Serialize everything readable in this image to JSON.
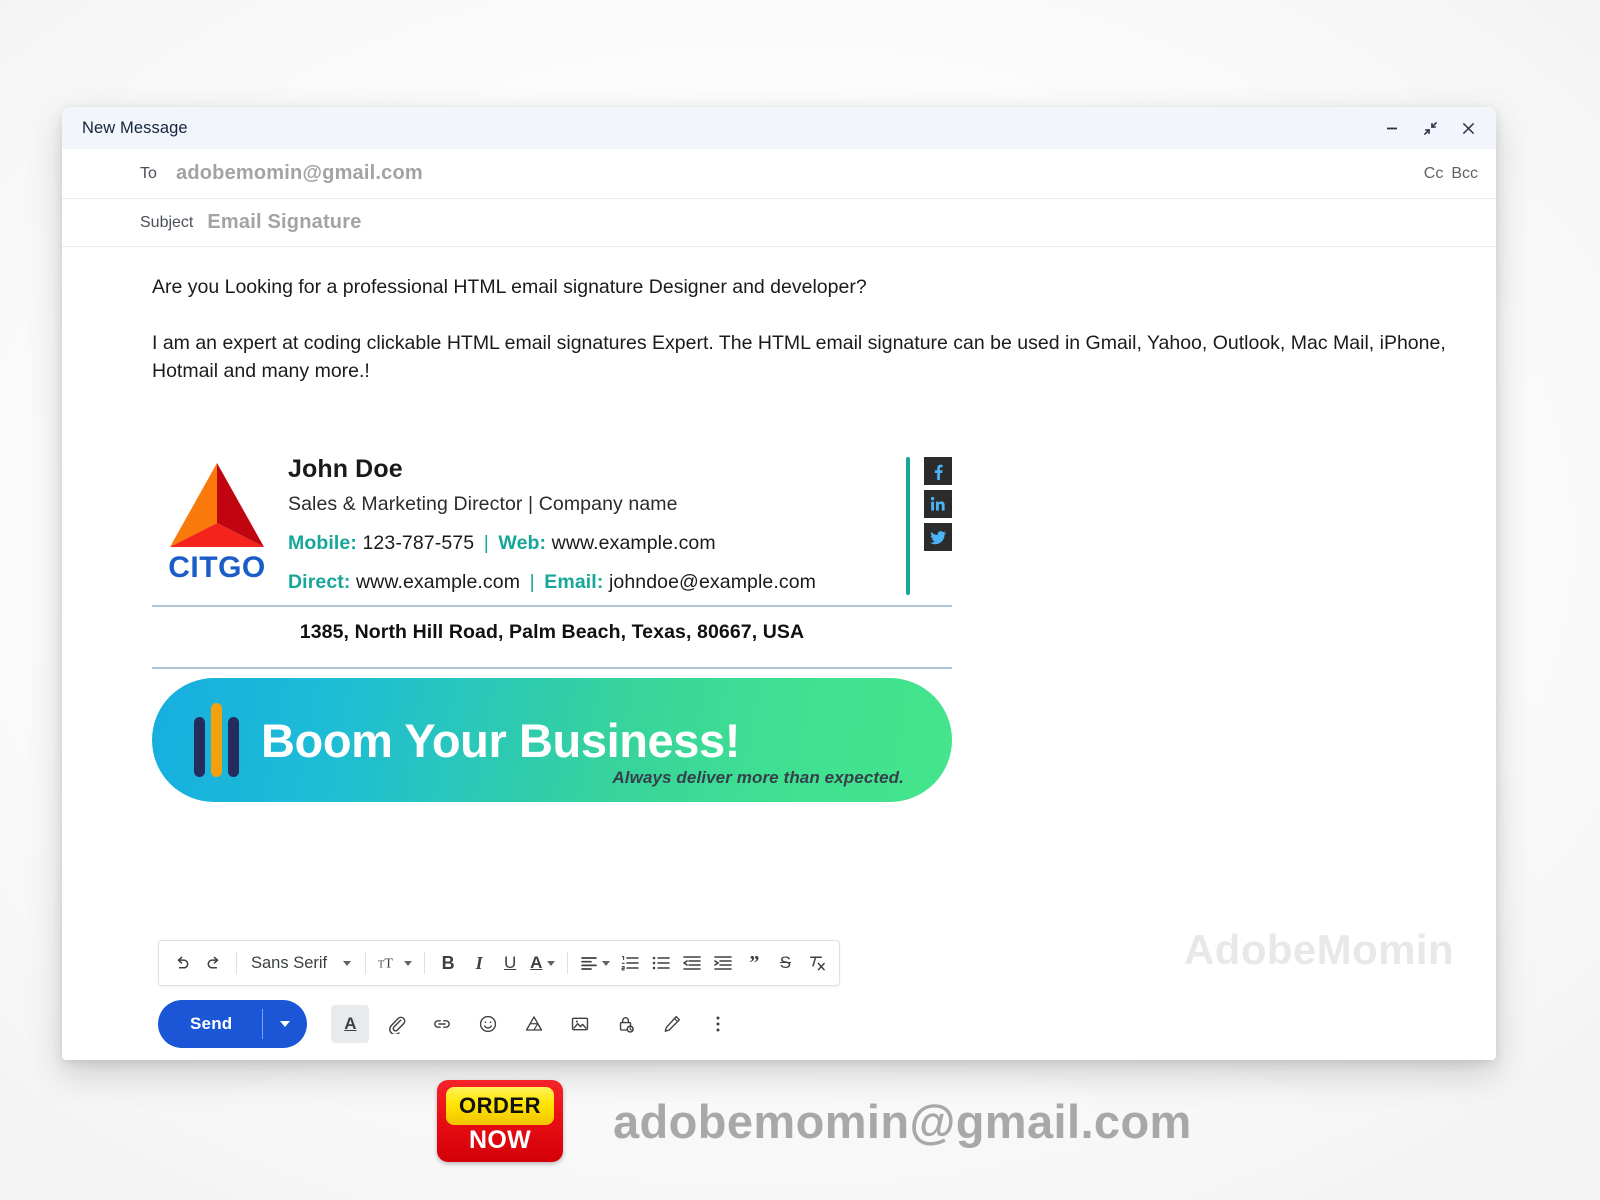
{
  "window": {
    "title": "New Message",
    "controls": [
      {
        "name": "minimize",
        "label": "–"
      },
      {
        "name": "exit-full-screen",
        "label": "↙↗"
      },
      {
        "name": "close",
        "label": "×"
      }
    ]
  },
  "fields": {
    "to_label": "To",
    "to_value": "adobemomin@gmail.com",
    "cc_label": "Cc",
    "bcc_label": "Bcc",
    "subject_label": "Subject",
    "subject_value": "Email Signature"
  },
  "body": {
    "paragraph1": "Are you Looking for a professional HTML email signature Designer and developer?",
    "paragraph2": "I am an expert at coding clickable HTML email signatures Expert. The HTML email signature can be used in Gmail, Yahoo, Outlook, Mac Mail, iPhone, Hotmail and many more.!",
    "watermark": "AdobeMomin"
  },
  "signature": {
    "logo_text": "CITGO",
    "name": "John Doe",
    "role": "Sales & Marketing Director | Company name",
    "contact_rows": [
      {
        "key1": "Mobile:",
        "val1": "123-787-575",
        "key2": "Web:",
        "val2": "www.example.com"
      },
      {
        "key1": "Direct:",
        "val1": "www.example.com",
        "key2": "Email:",
        "val2": "johndoe@example.com"
      }
    ],
    "separator": "|",
    "address": "1385, North Hill Road, Palm Beach, Texas, 80667, USA",
    "social": [
      {
        "name": "facebook-icon",
        "label": "f"
      },
      {
        "name": "linkedin-icon",
        "label": "in"
      },
      {
        "name": "twitter-icon",
        "label": "t"
      }
    ],
    "banner": {
      "headline": "Boom Your Business!",
      "tagline": "Always deliver more than expected."
    },
    "colors": {
      "accent_teal": "#18a69a",
      "logo_blue": "#1a5cc8",
      "rule": "#aec4d4",
      "banner_start": "#17aee0",
      "banner_end": "#45e58c"
    }
  },
  "format_toolbar": {
    "font_name": "Sans Serif",
    "buttons": [
      {
        "name": "undo-icon",
        "title": "Undo"
      },
      {
        "name": "redo-icon",
        "title": "Redo"
      },
      {
        "name": "font-family-select",
        "title": "Sans Serif"
      },
      {
        "name": "font-size-icon",
        "title": "Font size"
      },
      {
        "name": "bold-icon",
        "title": "Bold",
        "label": "B"
      },
      {
        "name": "italic-icon",
        "title": "Italic",
        "label": "I"
      },
      {
        "name": "underline-icon",
        "title": "Underline",
        "label": "U"
      },
      {
        "name": "text-color-icon",
        "title": "Text color",
        "label": "A"
      },
      {
        "name": "align-icon",
        "title": "Align"
      },
      {
        "name": "numbered-list-icon",
        "title": "Numbered list"
      },
      {
        "name": "bulleted-list-icon",
        "title": "Bulleted list"
      },
      {
        "name": "indent-less-icon",
        "title": "Indent less"
      },
      {
        "name": "indent-more-icon",
        "title": "Indent more"
      },
      {
        "name": "quote-icon",
        "title": "Quote",
        "label": "”"
      },
      {
        "name": "strikethrough-icon",
        "title": "Strikethrough",
        "label": "S"
      },
      {
        "name": "remove-formatting-icon",
        "title": "Remove formatting"
      }
    ]
  },
  "action_bar": {
    "send_label": "Send",
    "send_options_icon": "chevron-down-icon",
    "icons": [
      {
        "name": "formatting-options-icon",
        "title": "Formatting options",
        "active": true
      },
      {
        "name": "attach-file-icon",
        "title": "Attach files"
      },
      {
        "name": "insert-link-icon",
        "title": "Insert link"
      },
      {
        "name": "insert-emoji-icon",
        "title": "Insert emoji"
      },
      {
        "name": "insert-drive-icon",
        "title": "Insert files using Drive"
      },
      {
        "name": "insert-photo-icon",
        "title": "Insert photo"
      },
      {
        "name": "confidential-mode-icon",
        "title": "Toggle confidential mode"
      },
      {
        "name": "insert-signature-icon",
        "title": "Insert signature"
      },
      {
        "name": "more-options-icon",
        "title": "More options"
      }
    ]
  },
  "footer": {
    "order_top": "ORDER",
    "order_bottom": "NOW",
    "email": "adobemomin@gmail.com"
  }
}
